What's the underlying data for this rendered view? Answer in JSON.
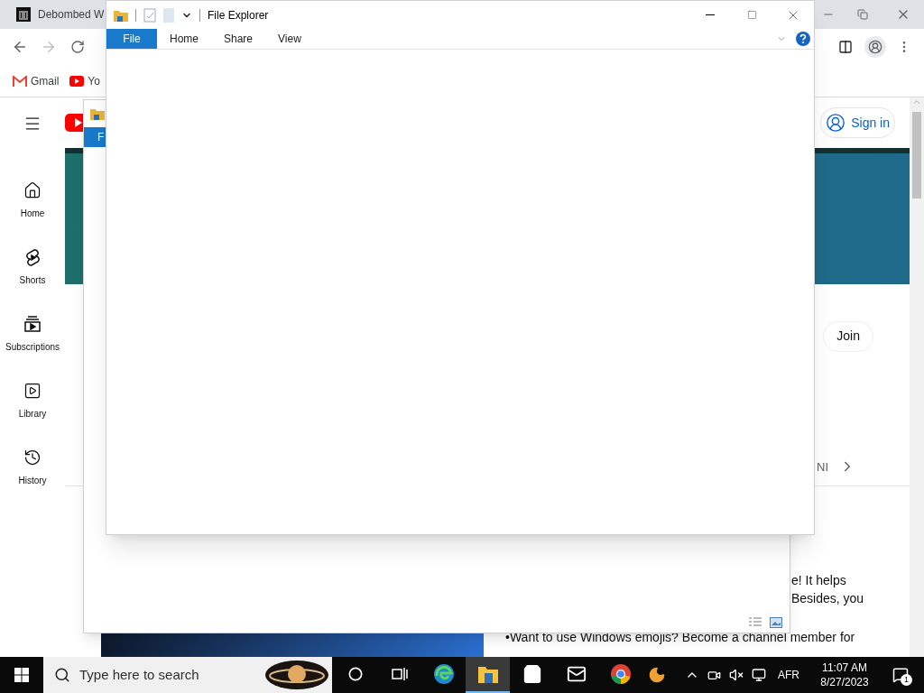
{
  "browser": {
    "tab_title": "Debombed W",
    "bookmarks": [
      {
        "label": "Gmail",
        "kind": "gmail"
      },
      {
        "label": "Yo",
        "kind": "youtube"
      }
    ]
  },
  "youtube": {
    "sign_in": "Sign in",
    "sidebar": [
      {
        "label": "Home",
        "kind": "home"
      },
      {
        "label": "Shorts",
        "kind": "shorts"
      },
      {
        "label": "Subscriptions",
        "kind": "subscriptions"
      },
      {
        "label": "Library",
        "kind": "library"
      },
      {
        "label": "History",
        "kind": "history"
      }
    ],
    "join": "Join",
    "chip_fragment": "NI",
    "description_lines": [
      "e! It helps",
      "Besides, you"
    ],
    "bullet_text": "•Want to use Windows emojis? Become a channel member for"
  },
  "back_explorer": {
    "ribbon_tab": "F"
  },
  "explorer": {
    "title": "File Explorer",
    "ribbon_tabs": [
      {
        "label": "File",
        "selected": true
      },
      {
        "label": "Home",
        "selected": false
      },
      {
        "label": "Share",
        "selected": false
      },
      {
        "label": "View",
        "selected": false
      }
    ]
  },
  "taskbar": {
    "search_placeholder": "Type here to search",
    "apps": [
      {
        "kind": "cortana",
        "active": false
      },
      {
        "kind": "taskview",
        "active": false
      },
      {
        "kind": "edge",
        "active": false
      },
      {
        "kind": "explorer",
        "active": true
      },
      {
        "kind": "store",
        "active": false
      },
      {
        "kind": "mail",
        "active": false
      },
      {
        "kind": "chrome",
        "active": false
      }
    ],
    "language": "AFR",
    "time": "11:07 AM",
    "date": "8/27/2023",
    "notification_count": "1"
  }
}
